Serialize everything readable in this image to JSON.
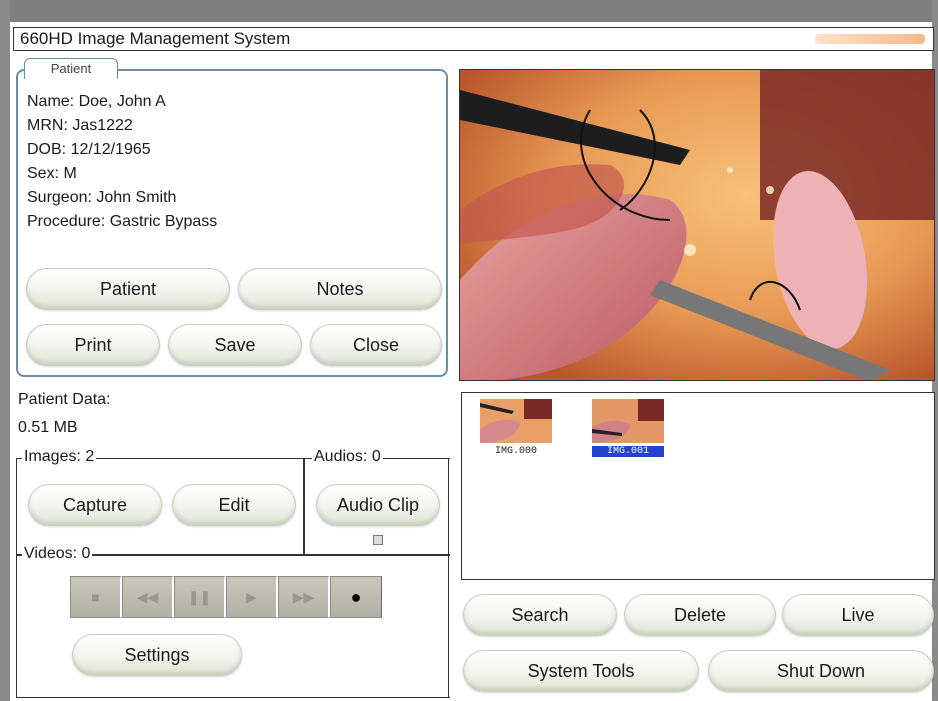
{
  "window": {
    "title": "660HD Image Management System"
  },
  "patient": {
    "tab_label": "Patient",
    "name": "Name: Doe, John A",
    "mrn": "MRN: Jas1222",
    "dob": "DOB: 12/12/1965",
    "sex": "Sex: M",
    "surgeon": "Surgeon: John Smith",
    "procedure": "Procedure: Gastric Bypass",
    "buttons": {
      "patient": "Patient",
      "notes": "Notes",
      "print": "Print",
      "save": "Save",
      "close": "Close"
    }
  },
  "patient_data": {
    "label": "Patient Data:",
    "size": "0.51 MB",
    "images_label": "Images: 2",
    "audios_label": "Audios: 0",
    "videos_label": "Videos: 0",
    "capture": "Capture",
    "edit": "Edit",
    "audio_clip": "Audio Clip",
    "settings": "Settings",
    "transport_icons": [
      "stop-icon",
      "rewind-icon",
      "pause-icon",
      "play-icon",
      "fast-forward-icon",
      "record-icon"
    ]
  },
  "thumbnails": [
    {
      "caption": "IMG.000",
      "selected": false
    },
    {
      "caption": "IMG.001",
      "selected": true
    }
  ],
  "actions": {
    "search": "Search",
    "delete": "Delete",
    "live": "Live",
    "system_tools": "System Tools",
    "shut_down": "Shut Down"
  },
  "colors": {
    "panel_border": "#6a8ea6",
    "selection": "#2244cc",
    "frame": "#7f7f7f"
  }
}
